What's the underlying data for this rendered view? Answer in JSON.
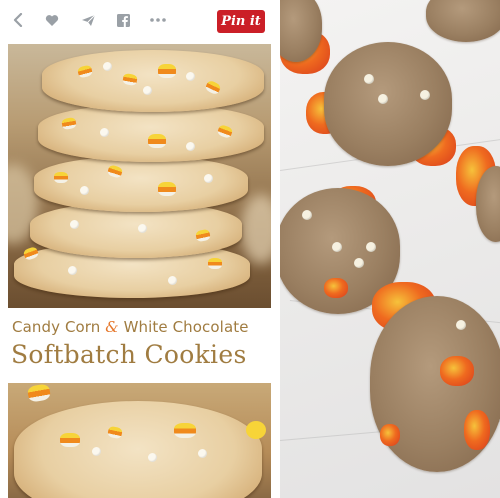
{
  "toolbar": {
    "pin_label": "Pin it",
    "pin_color": "#cb1f27",
    "icons": [
      "back-chevron-icon",
      "heart-icon",
      "send-icon",
      "facebook-icon",
      "more-icon"
    ]
  },
  "pin": {
    "title_line1_a": "Candy Corn",
    "title_line1_amp": "&",
    "title_line1_b": "White Chocolate",
    "title_line2": "Softbatch Cookies",
    "text_color": "#a07c41"
  }
}
